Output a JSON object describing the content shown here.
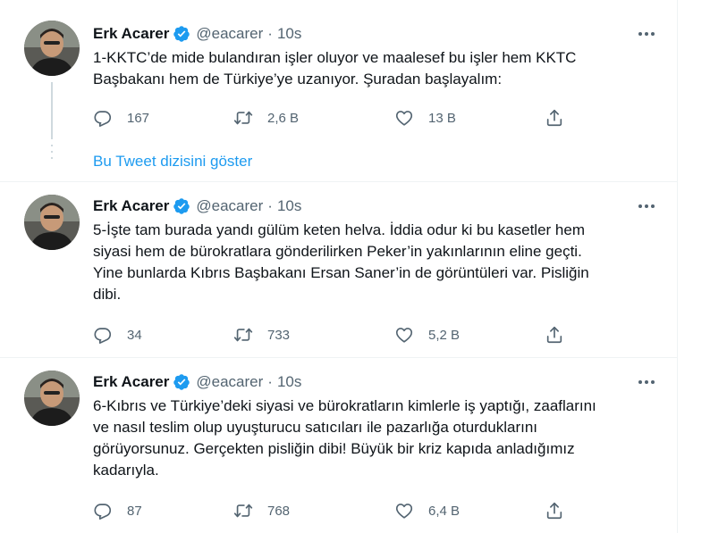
{
  "tweets": [
    {
      "author": "Erk Acarer",
      "handle": "@eacarer",
      "separator": "·",
      "time": "10s",
      "text": "1-KKTC’de mide bulandıran işler oluyor ve maalesef bu işler hem KKTC\nBaşbakanı hem de Türkiye’ye uzanıyor. Şuradan başlayalım:",
      "replies": "167",
      "retweets": "2,6 B",
      "likes": "13 B"
    },
    {
      "author": "Erk Acarer",
      "handle": "@eacarer",
      "separator": "·",
      "time": "10s",
      "text": "5-İşte tam burada yandı gülüm keten helva. İddia odur ki bu kasetler hem\nsiyasi hem de bürokratlara gönderilirken Peker’in yakınlarının eline geçti.\nYine bunlarda Kıbrıs Başbakanı Ersan Saner’in de görüntüleri var. Pisliğin\ndibi.",
      "replies": "34",
      "retweets": "733",
      "likes": "5,2 B"
    },
    {
      "author": "Erk Acarer",
      "handle": "@eacarer",
      "separator": "·",
      "time": "10s",
      "text": "6-Kıbrıs ve Türkiye’deki siyasi ve bürokratların kimlerle iş yaptığı, zaaflarını\nve nasıl teslim olup uyuşturucu satıcıları ile pazarlığa oturduklarını\ngörüyorsunuz. Gerçekten pisliğin dibi! Büyük bir kriz kapıda anladığımız\nkadarıyla.",
      "replies": "87",
      "retweets": "768",
      "likes": "6,4 B"
    }
  ],
  "thread": {
    "show_thread_label": "Bu Tweet dizisini göster"
  },
  "icons": {
    "verified": "verified-badge-icon",
    "more": "more-icon",
    "reply": "reply-icon",
    "retweet": "retweet-icon",
    "like": "heart-icon",
    "share": "share-icon"
  },
  "colors": {
    "accent": "#1d9bf0",
    "text": "#0f1419",
    "secondary": "#536471",
    "border": "#eff3f4"
  }
}
